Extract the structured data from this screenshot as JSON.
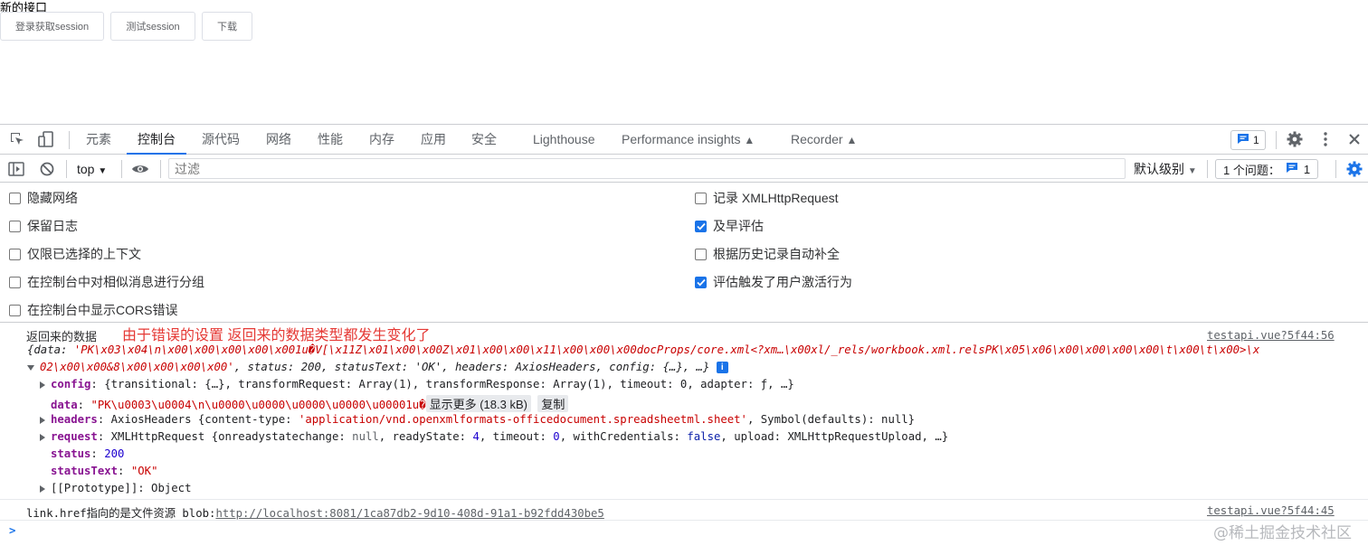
{
  "page": {
    "title": "新的接口",
    "buttons": [
      "登录获取session",
      "测试session",
      "下载"
    ]
  },
  "devtools": {
    "tabs": [
      "元素",
      "控制台",
      "源代码",
      "网络",
      "性能",
      "内存",
      "应用",
      "安全",
      "Lighthouse",
      "Performance insights",
      "Recorder"
    ],
    "active_tab": "控制台",
    "issue_count": "1",
    "toolbar": {
      "context": "top",
      "filter_placeholder": "过滤",
      "level": "默认级别",
      "issues_label": "1 个问题：",
      "issues_count": "1"
    },
    "settings_left": [
      {
        "label": "隐藏网络",
        "checked": false
      },
      {
        "label": "保留日志",
        "checked": false
      },
      {
        "label": "仅限已选择的上下文",
        "checked": false
      },
      {
        "label": "在控制台中对相似消息进行分组",
        "checked": false
      },
      {
        "label": "在控制台中显示CORS错误",
        "checked": false
      }
    ],
    "settings_right": [
      {
        "label": "记录 XMLHttpRequest",
        "checked": false
      },
      {
        "label": "及早评估",
        "checked": true
      },
      {
        "label": "根据历史记录自动补全",
        "checked": false
      },
      {
        "label": "评估触发了用户激活行为",
        "checked": true
      }
    ],
    "console": {
      "msg1_label": "返回来的数据",
      "annotation": "由于错误的设置 返回来的数据类型都发生变化了",
      "msg1_source": "testapi.vue?5f44:56",
      "summary_open": "{",
      "summary_data_key": "data",
      "summary_data_val_1": "'PK\\x03\\x04\\n\\x00\\x00\\x00\\x00\\x001u�V[\\x11Z\\x01\\x00\\x00Z\\x01\\x00\\x00\\x11\\x00\\x00\\x00docProps/core.xml<?xm…\\x00xl/_rels/workbook.xml.relsPK\\x05\\x06\\x00\\x00\\x00\\x00\\t\\x00\\t\\x00>\\x",
      "summary_data_val_2": "02\\x00\\x00&8\\x00\\x00\\x00\\x00'",
      "summary_rest": ", status: 200, statusText: 'OK', headers: AxiosHeaders, config: {…}, …}",
      "config_key": "config",
      "config_val": "{transitional: {…}, transformRequest: Array(1), transformResponse: Array(1), timeout: 0, adapter: ƒ, …}",
      "data_key": "data",
      "data_val": "\"PK\\u0003\\u0004\\n\\u0000\\u0000\\u0000\\u0000\\u00001u�",
      "show_more": "显示更多 (18.3 kB)",
      "copy": "复制",
      "headers_key": "headers",
      "headers_pre": "AxiosHeaders {content-type: ",
      "headers_str": "'application/vnd.openxmlformats-officedocument.spreadsheetml.sheet'",
      "headers_post": ", Symbol(defaults): null}",
      "request_key": "request",
      "request_pre": "XMLHttpRequest {onreadystatechange: ",
      "request_null": "null",
      "request_mid1": ", readyState: ",
      "request_4": "4",
      "request_mid2": ", timeout: ",
      "request_0": "0",
      "request_mid3": ", withCredentials: ",
      "request_false": "false",
      "request_post": ", upload: XMLHttpRequestUpload, …}",
      "status_key": "status",
      "status_val": "200",
      "statustext_key": "statusText",
      "statustext_val": "\"OK\"",
      "proto": "[[Prototype]]: Object",
      "msg2_text": "link.href指向的是文件资源 blob:",
      "msg2_link": "http://localhost:8081/1ca87db2-9d10-408d-91a1-b92fdd430be5",
      "msg2_source": "testapi.vue?5f44:45",
      "prompt": ">"
    },
    "watermark": "@稀土掘金技术社区"
  },
  "colors": {
    "accent": "#1a73e8",
    "string": "#c80000",
    "key": "#881391",
    "number": "#1c00cf"
  }
}
